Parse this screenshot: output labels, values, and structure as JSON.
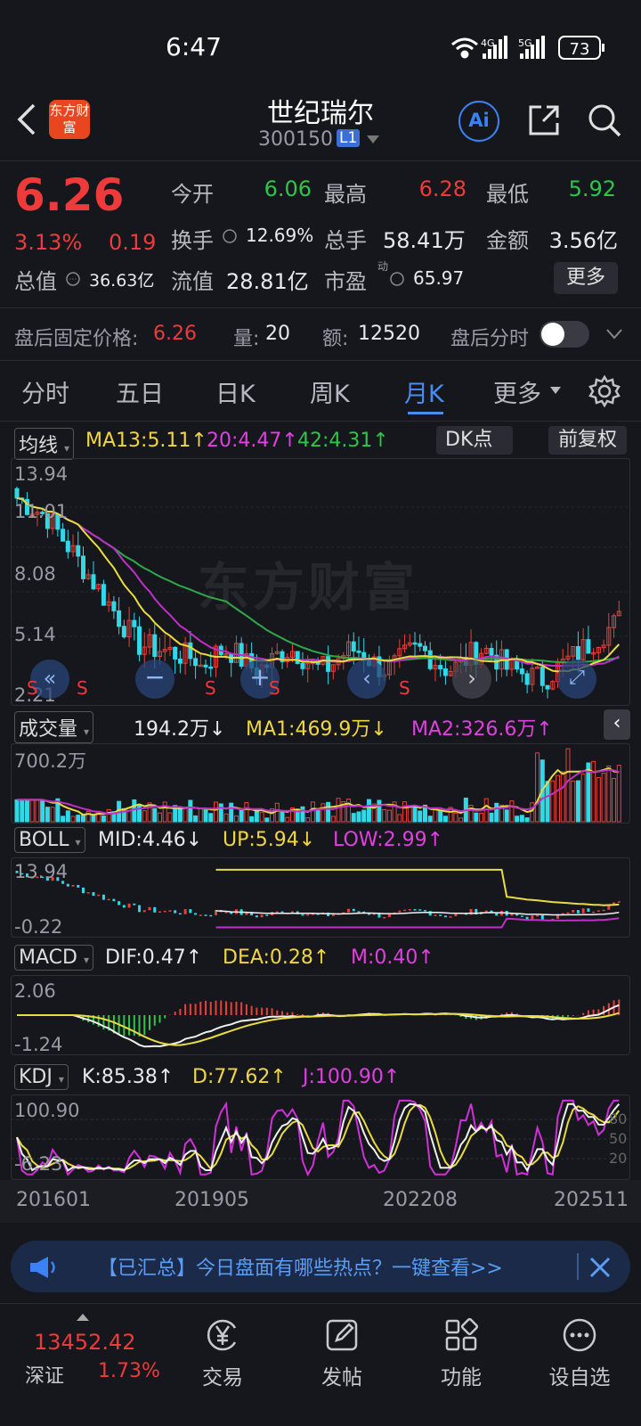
{
  "status": {
    "time": "6:47",
    "net1": "4G",
    "net2": "5G",
    "battery": "73"
  },
  "header": {
    "logo_text": "东方财富",
    "title": "世纪瑞尔",
    "code": "300150",
    "level": "L1",
    "ai_label": "Ai"
  },
  "quote": {
    "price": "6.26",
    "pct": "3.13%",
    "chg": "0.19",
    "open_label": "今开",
    "open": "6.06",
    "high_label": "最高",
    "high": "6.28",
    "low_label": "最低",
    "low": "5.92",
    "turnover_label": "换手",
    "turnover": "12.69%",
    "vol_label": "总手",
    "vol": "58.41万",
    "amt_label": "金额",
    "amt": "3.56亿",
    "mktcap_label": "总值",
    "mktcap": "36.63亿",
    "float_label": "流值",
    "float": "28.81亿",
    "pe_label": "市盈",
    "pe_sup": "动",
    "pe": "65.97",
    "more": "更多"
  },
  "afterhours": {
    "price_label": "盘后固定价格:",
    "price": "6.26",
    "vol_label": "量:",
    "vol": "20",
    "amt_label": "额:",
    "amt": "12520",
    "tl_label": "盘后分时"
  },
  "tabs": [
    "分时",
    "五日",
    "日K",
    "周K",
    "月K",
    "更多"
  ],
  "active_tab": "月K",
  "kline": {
    "ma_label": "均线",
    "ma13": "MA13:5.11↑",
    "ma20": "20:4.47↑",
    "ma42": "42:4.31↑",
    "dk": "DK点",
    "fq": "前复权",
    "axis": [
      "13.94",
      "11.01",
      "8.08",
      "5.14",
      "2.21"
    ],
    "watermark": "东方财富",
    "s_mark": "S"
  },
  "volume": {
    "label": "成交量",
    "val": "194.2万↓",
    "ma1": "MA1:469.9万↓",
    "ma2": "MA2:326.6万↑",
    "axis": "700.2万"
  },
  "boll": {
    "label": "BOLL",
    "mid": "MID:4.46↓",
    "up": "UP:5.94↓",
    "low": "LOW:2.99↑",
    "axis_top": "13.94",
    "axis_bot": "-0.22"
  },
  "macd": {
    "label": "MACD",
    "dif": "DIF:0.47↑",
    "dea": "DEA:0.28↑",
    "m": "M:0.40↑",
    "axis_top": "2.06",
    "axis_bot": "-1.24"
  },
  "kdj": {
    "label": "KDJ",
    "k": "K:85.38↑",
    "d": "D:77.62↑",
    "j": "J:100.90↑",
    "axis_top": "100.90",
    "axis_bot": "-6.23",
    "l80": "80",
    "l50": "50",
    "l20": "20"
  },
  "dates": [
    "201601",
    "201905",
    "202208",
    "202511"
  ],
  "banner": {
    "text": "【已汇总】今日盘面有哪些热点？一键查看>>"
  },
  "bottom": {
    "index_val": "13452.42",
    "index_name": "深证",
    "index_pct": "1.73%",
    "trade": "交易",
    "post": "发帖",
    "func": "功能",
    "watch": "设自选"
  }
}
